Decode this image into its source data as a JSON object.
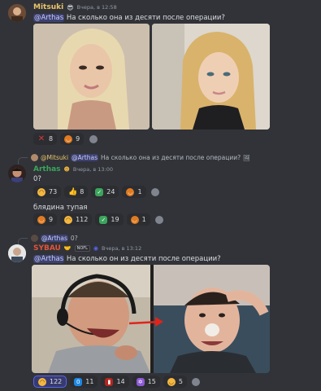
{
  "messages": [
    {
      "username": "Mitsuki",
      "name_color": "#e8c56a",
      "timestamp": "Вчера, в 12:58",
      "mention": "@Arthas",
      "text": "На сколько она из десяти после операции?",
      "reactions": [
        {
          "icon": "red-x-icon",
          "count": "8",
          "color": "#da373c"
        },
        {
          "icon": "orange-face-icon",
          "count": "9",
          "color": "#e07b22"
        }
      ]
    },
    {
      "reply": {
        "author": "@Mitsuki",
        "mention": "@Arthas",
        "text": "На сколько она из десяти после операции?"
      },
      "username": "Arthas",
      "name_color": "#3ba55c",
      "timestamp": "Вчера, в 13:00",
      "text": "0?",
      "reactions": [
        {
          "icon": "grin-face-icon",
          "count": "73",
          "color": "#f4b740"
        },
        {
          "icon": "thumbs-up-icon",
          "count": "8",
          "color": "#f4b740"
        },
        {
          "icon": "check-mark-icon",
          "count": "24",
          "color": "#3ba55c"
        },
        {
          "icon": "orange-face-icon",
          "count": "1",
          "color": "#e07b22"
        }
      ],
      "text2": "блядина тупая",
      "reactions2": [
        {
          "icon": "horns-face-icon",
          "count": "9",
          "color": "#e07b22"
        },
        {
          "icon": "grin-face-icon",
          "count": "112",
          "color": "#f4b740"
        },
        {
          "icon": "check-mark-icon",
          "count": "19",
          "color": "#3ba55c"
        },
        {
          "icon": "orange-face-icon",
          "count": "1",
          "color": "#e07b22"
        }
      ]
    },
    {
      "reply": {
        "mention": "@Arthas",
        "text": "0?"
      },
      "username": "SYBAU",
      "name_color": "#e0543a",
      "badge": "NOFL",
      "timestamp": "Вчера, в 13:12",
      "mention": "@Arthas",
      "text": "На сколько он из десяти после операции?",
      "reactions": [
        {
          "icon": "grin-face-icon",
          "count": "122",
          "color": "#f4b740",
          "me": true
        },
        {
          "icon": "zero-icon",
          "count": "11",
          "color": "#1e88e5"
        },
        {
          "icon": "flag-icon",
          "count": "14",
          "color": "#b3261e"
        },
        {
          "icon": "sparkle-icon",
          "count": "15",
          "color": "#8e5bd6"
        },
        {
          "icon": "dizzy-face-icon",
          "count": "5",
          "color": "#f4b740"
        }
      ]
    }
  ]
}
